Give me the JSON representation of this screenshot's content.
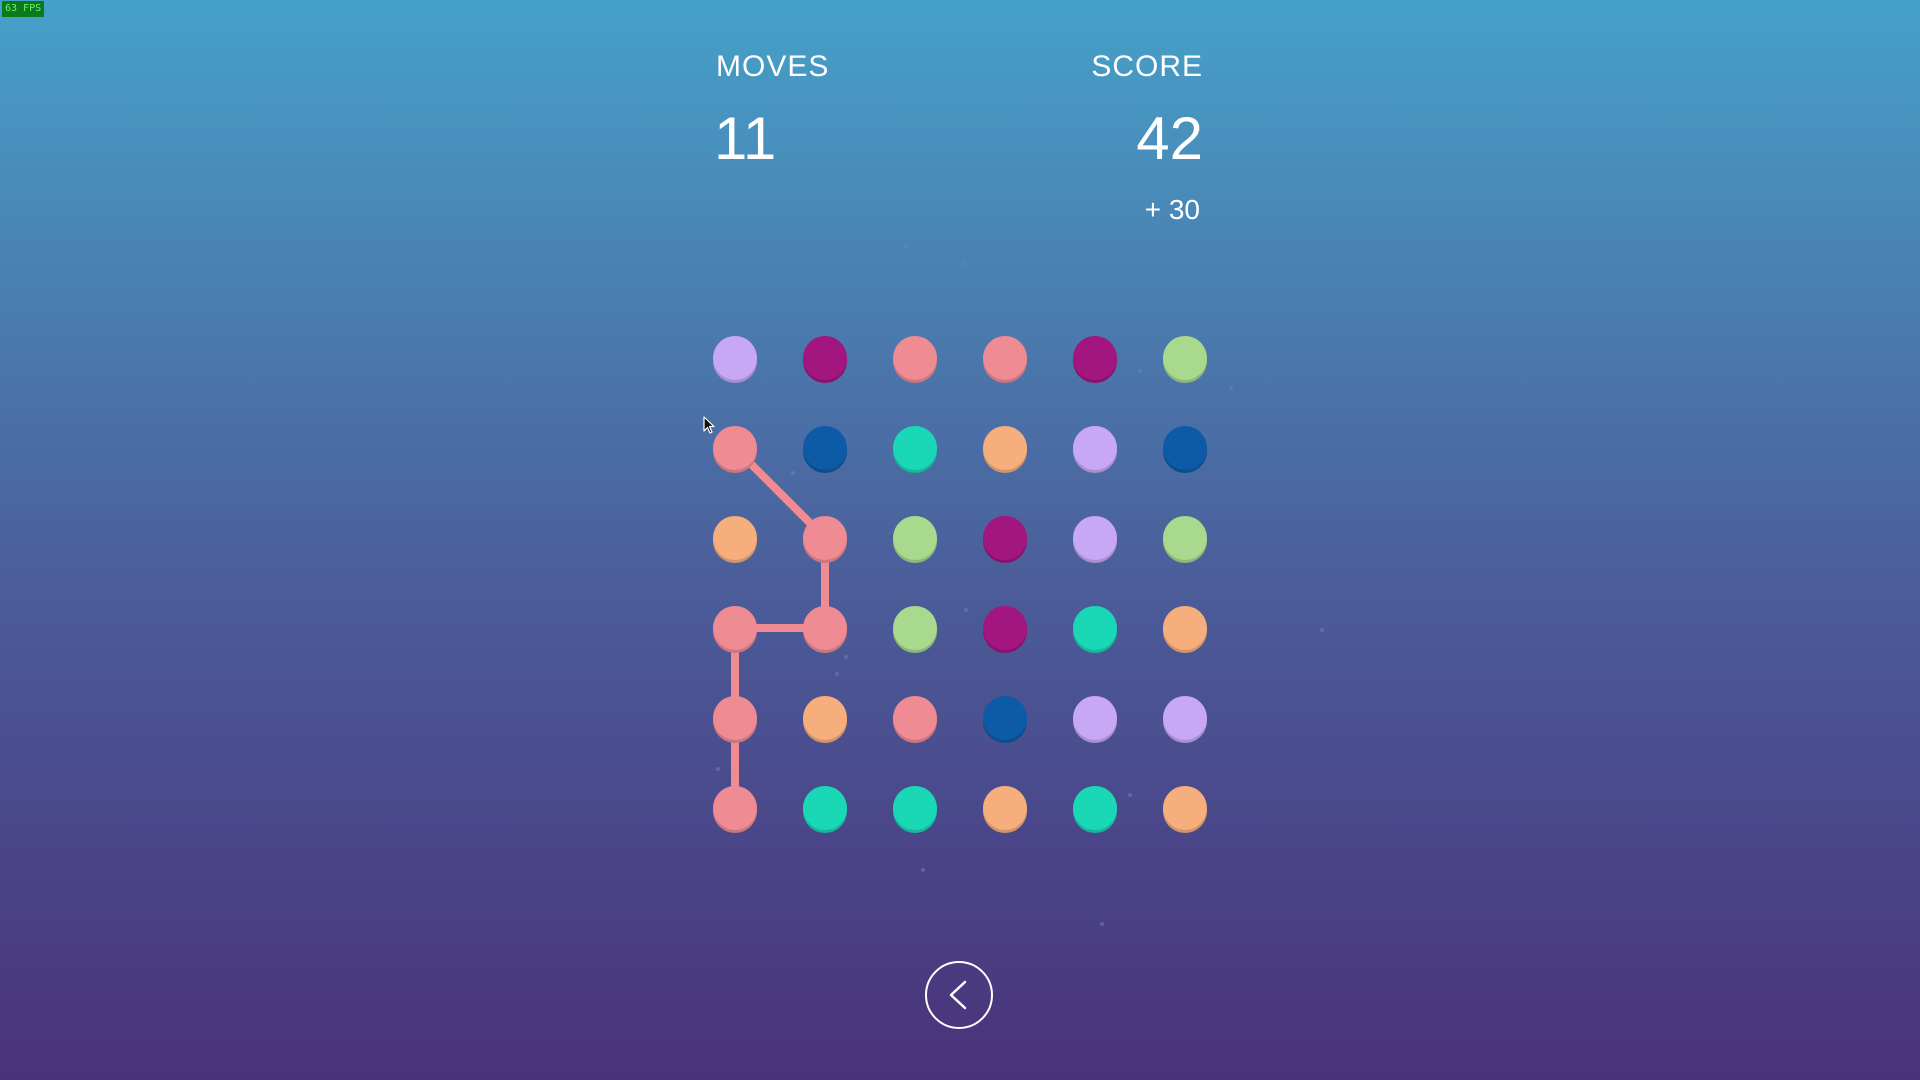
{
  "fps": "63 FPS",
  "hud": {
    "moves_label": "MOVES",
    "moves_value": "11",
    "score_label": "SCORE",
    "score_value": "42",
    "bonus": "+ 30"
  },
  "palette": {
    "lavender": "#c8a7f5",
    "magenta": "#a3157f",
    "pink": "#ef8b92",
    "orange": "#f6ae7c",
    "green": "#a8d98d",
    "blue": "#0d5aa6",
    "teal": "#1ad8b6"
  },
  "board": {
    "rows": [
      [
        "lavender",
        "magenta",
        "pink",
        "pink",
        "magenta",
        "green"
      ],
      [
        "pink",
        "blue",
        "teal",
        "orange",
        "lavender",
        "blue"
      ],
      [
        "orange",
        "pink",
        "green",
        "magenta",
        "lavender",
        "green"
      ],
      [
        "pink",
        "pink",
        "green",
        "magenta",
        "teal",
        "orange"
      ],
      [
        "pink",
        "orange",
        "pink",
        "blue",
        "lavender",
        "lavender"
      ],
      [
        "pink",
        "teal",
        "teal",
        "orange",
        "teal",
        "orange"
      ]
    ],
    "selected_path": [
      [
        1,
        0
      ],
      [
        2,
        1
      ],
      [
        3,
        1
      ],
      [
        3,
        0
      ],
      [
        4,
        0
      ],
      [
        5,
        0
      ]
    ],
    "path_color": "pink"
  },
  "back_button": {
    "icon": "chevron-left-icon"
  }
}
